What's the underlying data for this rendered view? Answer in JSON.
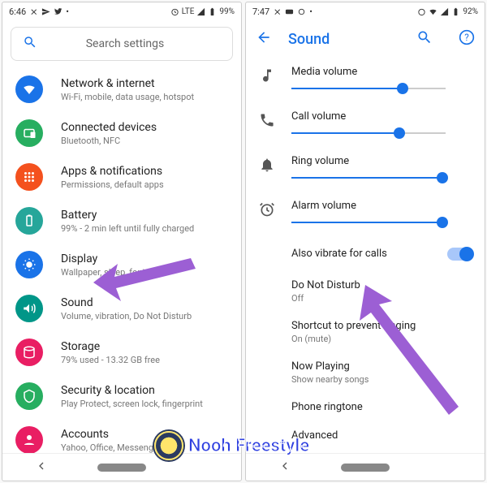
{
  "left": {
    "status": {
      "time": "6:46",
      "battery": "99%",
      "net": "LTE"
    },
    "search_placeholder": "Search settings",
    "items": [
      {
        "title": "Network & internet",
        "sub": "Wi-Fi, mobile, data usage, hotspot",
        "color": "#1a73e8",
        "icon": "wifi"
      },
      {
        "title": "Connected devices",
        "sub": "Bluetooth, NFC",
        "color": "#27ae60",
        "icon": "devices"
      },
      {
        "title": "Apps & notifications",
        "sub": "Permissions, default apps",
        "color": "#f4511e",
        "icon": "apps"
      },
      {
        "title": "Battery",
        "sub": "99% - 2 min left until fully charged",
        "color": "#26a69a",
        "icon": "battery"
      },
      {
        "title": "Display",
        "sub": "Wallpaper, sleep, font size",
        "color": "#1a73e8",
        "icon": "display"
      },
      {
        "title": "Sound",
        "sub": "Volume, vibration, Do Not Disturb",
        "color": "#009688",
        "icon": "sound"
      },
      {
        "title": "Storage",
        "sub": "79% used - 13.32 GB free",
        "color": "#e91e63",
        "icon": "storage"
      },
      {
        "title": "Security & location",
        "sub": "Play Protect, screen lock, fingerprint",
        "color": "#27ae60",
        "icon": "security"
      },
      {
        "title": "Accounts",
        "sub": "Yahoo, Office, Messenger",
        "color": "#e91e63",
        "icon": "accounts"
      }
    ]
  },
  "right": {
    "status": {
      "time": "7:47",
      "battery": "92%"
    },
    "title": "Sound",
    "sliders": [
      {
        "label": "Media volume",
        "value": 0.72,
        "icon": "music"
      },
      {
        "label": "Call volume",
        "value": 0.7,
        "icon": "phone"
      },
      {
        "label": "Ring volume",
        "value": 0.98,
        "icon": "bell"
      },
      {
        "label": "Alarm volume",
        "value": 0.98,
        "icon": "alarm"
      }
    ],
    "vibrate_label": "Also vibrate for calls",
    "vibrate_on": true,
    "items": [
      {
        "title": "Do Not Disturb",
        "sub": "Off"
      },
      {
        "title": "Shortcut to prevent ringing",
        "sub": "On (mute)"
      },
      {
        "title": "Now Playing",
        "sub": "Show nearby songs"
      },
      {
        "title": "Phone ringtone",
        "sub": ""
      },
      {
        "title": "Advanced",
        "sub": ""
      }
    ]
  },
  "watermark": "Nooh Freestyle"
}
